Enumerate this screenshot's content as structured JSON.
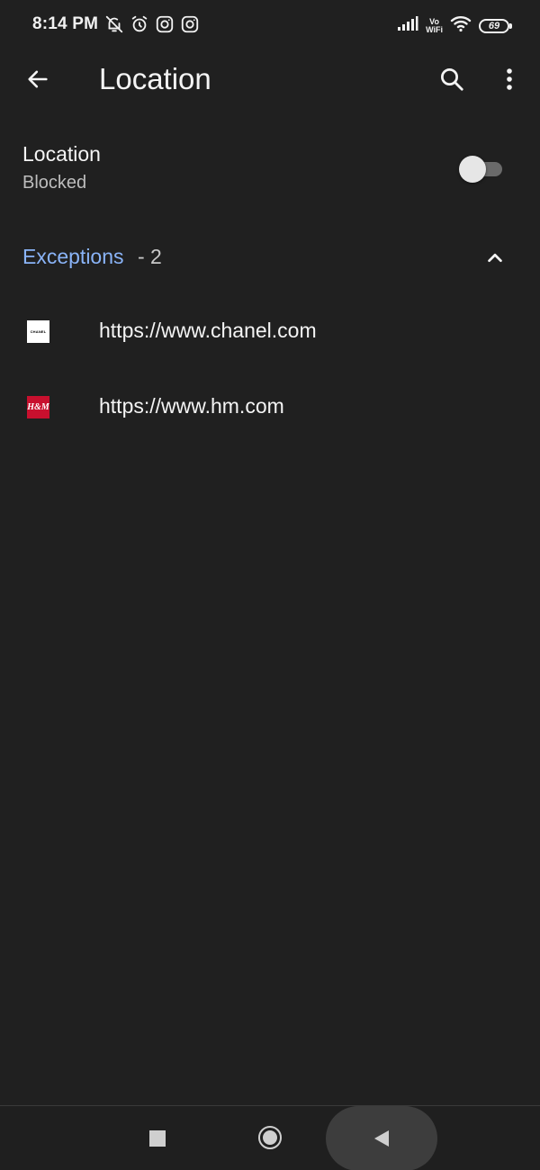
{
  "status_bar": {
    "time": "8:14 PM",
    "left_icons": [
      "bell-off-icon",
      "alarm-icon",
      "instagram-icon",
      "instagram-icon"
    ],
    "right_icons": [
      "signal-icon",
      "vowifi-icon",
      "wifi-icon",
      "battery-icon"
    ],
    "vowifi_top": "Vo",
    "vowifi_bottom": "WiFi",
    "battery_level": "69"
  },
  "toolbar": {
    "title": "Location",
    "back_icon": "arrow-back-icon",
    "search_icon": "search-icon",
    "more_icon": "more-vert-icon"
  },
  "setting": {
    "title": "Location",
    "subtitle": "Blocked",
    "toggle_on": false
  },
  "exceptions": {
    "label": "Exceptions",
    "count_text": "- 2",
    "collapse_icon": "chevron-up-icon"
  },
  "sites": [
    {
      "url": "https://www.chanel.com",
      "favicon_text": "CHANEL",
      "favicon_icon": "chanel-favicon-icon"
    },
    {
      "url": "https://www.hm.com",
      "favicon_text": "H&M",
      "favicon_icon": "hm-favicon-icon"
    }
  ],
  "nav_bar": {
    "recents_icon": "square-recents-icon",
    "home_icon": "circle-home-icon",
    "back_icon": "triangle-back-icon"
  },
  "colors": {
    "background": "#202020",
    "accent": "#8ab4f8",
    "text_primary": "#f4f4f4",
    "text_secondary": "#bdbdbd"
  }
}
